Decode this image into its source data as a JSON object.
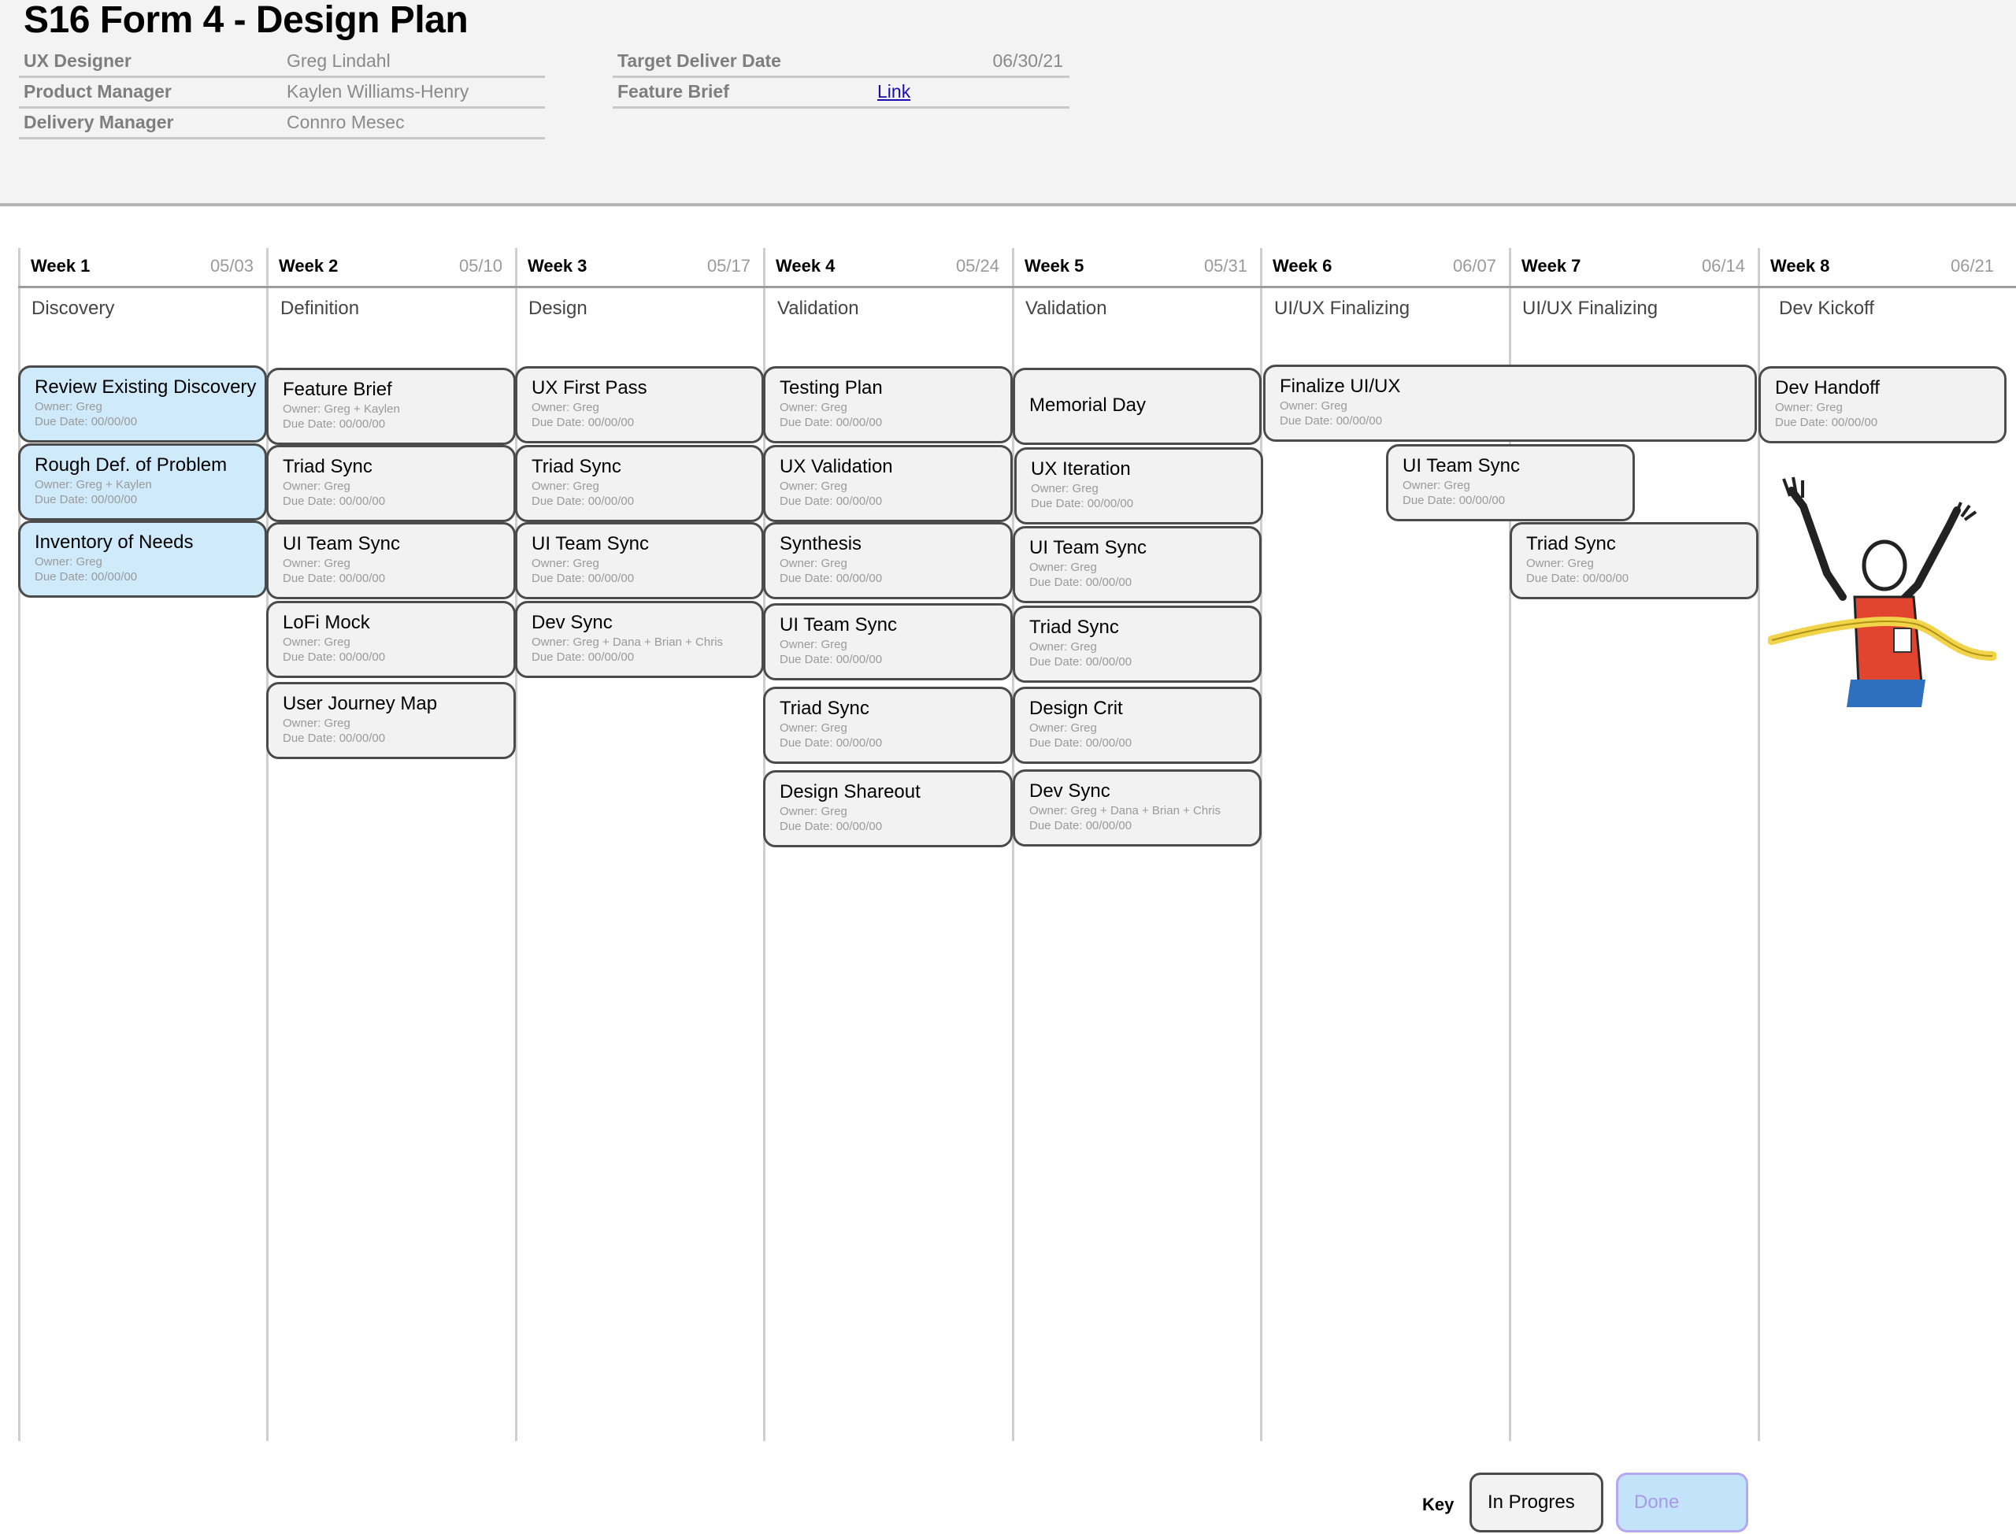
{
  "header": {
    "title": "S16 Form 4 - Design Plan",
    "fields_left": [
      {
        "label": "UX Designer",
        "value": "Greg Lindahl"
      },
      {
        "label": "Product  Manager",
        "value": "Kaylen Williams-Henry"
      },
      {
        "label": "Delivery Manager",
        "value": "Connro Mesec"
      }
    ],
    "fields_right": [
      {
        "label": "Target Deliver Date",
        "value": "06/30/21"
      },
      {
        "label": "Feature Brief",
        "value": "Link"
      }
    ]
  },
  "weeks": [
    {
      "name": "Week 1",
      "date": "05/03",
      "phase": "Discovery"
    },
    {
      "name": "Week 2",
      "date": "05/10",
      "phase": "Definition"
    },
    {
      "name": "Week 3",
      "date": "05/17",
      "phase": "Design"
    },
    {
      "name": "Week 4",
      "date": "05/24",
      "phase": "Validation"
    },
    {
      "name": "Week 5",
      "date": "05/31",
      "phase": "Validation"
    },
    {
      "name": "Week 6",
      "date": "06/07",
      "phase": "UI/UX Finalizing"
    },
    {
      "name": "Week 7",
      "date": "06/14",
      "phase": "UI/UX Finalizing"
    },
    {
      "name": "Week 8",
      "date": "06/21",
      "phase": "Dev Kickoff"
    }
  ],
  "tasks": [
    {
      "title": "Review Existing Discovery",
      "owner": "Owner: Greg",
      "due": "Due Date: 00/00/00",
      "status": "done"
    },
    {
      "title": "Rough Def.  of Problem",
      "owner": "Owner: Greg + Kaylen",
      "due": "Due Date: 00/00/00",
      "status": "done"
    },
    {
      "title": "Inventory of Needs",
      "owner": "Owner: Greg",
      "due": "Due Date: 00/00/00",
      "status": "done"
    },
    {
      "title": "Feature Brief",
      "owner": "Owner: Greg + Kaylen",
      "due": "Due Date: 00/00/00",
      "status": "in_progress"
    },
    {
      "title": "Triad Sync",
      "owner": "Owner: Greg",
      "due": "Due Date: 00/00/00",
      "status": "in_progress"
    },
    {
      "title": "UI Team Sync",
      "owner": "Owner: Greg",
      "due": "Due Date: 00/00/00",
      "status": "in_progress"
    },
    {
      "title": "LoFi Mock",
      "owner": "Owner: Greg",
      "due": "Due Date: 00/00/00",
      "status": "in_progress"
    },
    {
      "title": "User Journey Map",
      "owner": "Owner: Greg",
      "due": "Due Date: 00/00/00",
      "status": "in_progress"
    },
    {
      "title": "UX First Pass",
      "owner": "Owner: Greg",
      "due": "Due Date: 00/00/00",
      "status": "in_progress"
    },
    {
      "title": "Triad Sync",
      "owner": "Owner: Greg",
      "due": "Due Date: 00/00/00",
      "status": "in_progress"
    },
    {
      "title": "UI Team Sync",
      "owner": "Owner: Greg",
      "due": "Due Date: 00/00/00",
      "status": "in_progress"
    },
    {
      "title": "Dev Sync",
      "owner": "Owner: Greg + Dana + Brian + Chris",
      "due": "Due Date: 00/00/00",
      "status": "in_progress"
    },
    {
      "title": "Testing Plan",
      "owner": "Owner: Greg",
      "due": "Due Date: 00/00/00",
      "status": "in_progress"
    },
    {
      "title": "UX Validation",
      "owner": "Owner: Greg",
      "due": "Due Date: 00/00/00",
      "status": "in_progress"
    },
    {
      "title": "Synthesis",
      "owner": "Owner: Greg",
      "due": "Due Date: 00/00/00",
      "status": "in_progress"
    },
    {
      "title": "UI Team Sync",
      "owner": "Owner: Greg",
      "due": "Due Date: 00/00/00",
      "status": "in_progress"
    },
    {
      "title": "Triad Sync",
      "owner": "Owner: Greg",
      "due": "Due Date: 00/00/00",
      "status": "in_progress"
    },
    {
      "title": "Design Shareout",
      "owner": "Owner: Greg",
      "due": "Due Date: 00/00/00",
      "status": "in_progress"
    },
    {
      "title": "Memorial Day",
      "status": "in_progress"
    },
    {
      "title": "UX Iteration",
      "owner": "Owner: Greg",
      "due": "Due Date: 00/00/00",
      "status": "in_progress"
    },
    {
      "title": "UI Team Sync",
      "owner": "Owner: Greg",
      "due": "Due Date: 00/00/00",
      "status": "in_progress"
    },
    {
      "title": "Triad Sync",
      "owner": "Owner: Greg",
      "due": "Due Date: 00/00/00",
      "status": "in_progress"
    },
    {
      "title": "Design Crit",
      "owner": "Owner: Greg",
      "due": "Due Date: 00/00/00",
      "status": "in_progress"
    },
    {
      "title": "Dev Sync",
      "owner": "Owner: Greg + Dana + Brian + Chris",
      "due": "Due Date: 00/00/00",
      "status": "in_progress"
    },
    {
      "title": "Finalize UI/UX",
      "owner": "Owner: Greg",
      "due": "Due Date: 00/00/00",
      "status": "in_progress"
    },
    {
      "title": "UI Team Sync",
      "owner": "Owner: Greg",
      "due": "Due Date: 00/00/00",
      "status": "in_progress"
    },
    {
      "title": "Triad Sync",
      "owner": "Owner: Greg",
      "due": "Due Date: 00/00/00",
      "status": "in_progress"
    },
    {
      "title": "Dev Handoff",
      "owner": "Owner: Greg",
      "due": "Due Date: 00/00/00",
      "status": "in_progress"
    }
  ],
  "illustration": {
    "icon": "finish-line-runner-icon"
  },
  "key": {
    "label": "Key",
    "in_progress": "In Progres",
    "done": "Done"
  },
  "colors": {
    "done_fill": "#cfeafb",
    "in_progress_fill": "#f2f2f2",
    "card_border": "#4b4b4b",
    "link": "#1a0dab"
  }
}
